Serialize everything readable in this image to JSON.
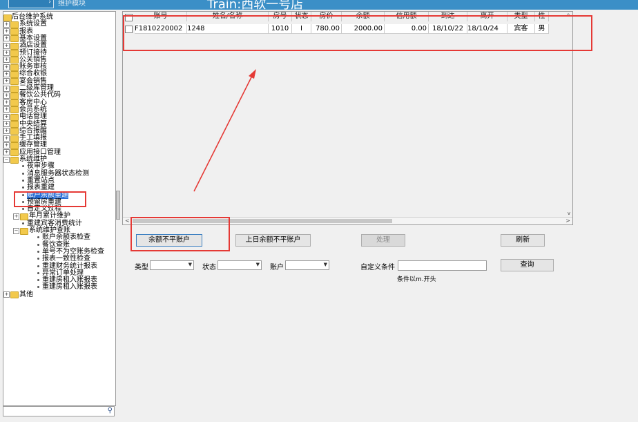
{
  "title": {
    "module_label": "维护模块",
    "hotel": "Train:西软一号店"
  },
  "tree": [
    {
      "label": "后台维护系统",
      "kind": "root"
    },
    {
      "label": "系统设置",
      "kind": "folder"
    },
    {
      "label": "报表",
      "kind": "folder"
    },
    {
      "label": "基本设置",
      "kind": "folder"
    },
    {
      "label": "酒店设置",
      "kind": "folder"
    },
    {
      "label": "预订接待",
      "kind": "folder"
    },
    {
      "label": "公关销售",
      "kind": "folder"
    },
    {
      "label": "账务审核",
      "kind": "folder"
    },
    {
      "label": "综合收银",
      "kind": "folder"
    },
    {
      "label": "宴会销售",
      "kind": "folder"
    },
    {
      "label": "二级库管理",
      "kind": "folder"
    },
    {
      "label": "餐饮公共代码",
      "kind": "folder"
    },
    {
      "label": "客房中心",
      "kind": "folder"
    },
    {
      "label": "会员系统",
      "kind": "folder"
    },
    {
      "label": "电话管理",
      "kind": "folder"
    },
    {
      "label": "中央结算",
      "kind": "folder"
    },
    {
      "label": "综合报醒",
      "kind": "folder"
    },
    {
      "label": "手工填报",
      "kind": "folder"
    },
    {
      "label": "缓存管理",
      "kind": "folder"
    },
    {
      "label": "应用接口管理",
      "kind": "folder"
    },
    {
      "label": "系统维护",
      "kind": "open-folder"
    },
    {
      "label": "夜审步骤",
      "kind": "leaf"
    },
    {
      "label": "消息服务器状态检测",
      "kind": "leaf"
    },
    {
      "label": "重置站点",
      "kind": "leaf"
    },
    {
      "label": "报表重建",
      "kind": "leaf"
    },
    {
      "label": "账户余额重建",
      "kind": "selected"
    },
    {
      "label": "预留房重建",
      "kind": "leaf"
    },
    {
      "label": "自定义过程",
      "kind": "leaf"
    },
    {
      "label": "年月累计维护",
      "kind": "subfolder"
    },
    {
      "label": "重建宾客消费统计",
      "kind": "leaf"
    },
    {
      "label": "系统维护查账",
      "kind": "open-subfolder"
    },
    {
      "label": "账户余额表检查",
      "kind": "leaf2"
    },
    {
      "label": "餐饮查账",
      "kind": "leaf2"
    },
    {
      "label": "单号不为空账务检查",
      "kind": "leaf2"
    },
    {
      "label": "报表一致性检查",
      "kind": "leaf2"
    },
    {
      "label": "重建财务统计报表",
      "kind": "leaf2"
    },
    {
      "label": "异常订单处理",
      "kind": "leaf2"
    },
    {
      "label": "重建房租入账报表",
      "kind": "leaf2"
    },
    {
      "label": "重建房租入账报表",
      "kind": "leaf2"
    },
    {
      "label": "其他",
      "kind": "folder"
    }
  ],
  "grid": {
    "headers": [
      "账号",
      "姓名/名称",
      "房号",
      "状态",
      "房价",
      "余额",
      "信用额",
      "到达",
      "离开",
      "类型",
      "性"
    ],
    "rows": [
      [
        "F1810220002",
        "1248",
        "1010",
        "I",
        "780.00",
        "2000.00",
        "0.00",
        "18/10/22",
        "18/10/24",
        "宾客",
        "男"
      ]
    ]
  },
  "buttons": {
    "unbalanced": "余额不平账户",
    "prev_day_unbalanced": "上日余额不平账户",
    "process": "处理",
    "refresh": "刷新",
    "query": "查询"
  },
  "filters": {
    "type_label": "类型",
    "status_label": "状态",
    "account_label": "账户",
    "custom_label": "自定义条件",
    "custom_hint": "条件以m.开头"
  },
  "colors": {
    "annotation": "#e53935",
    "titlebar": "#3b8fc7",
    "selection": "#2a6fd6"
  }
}
